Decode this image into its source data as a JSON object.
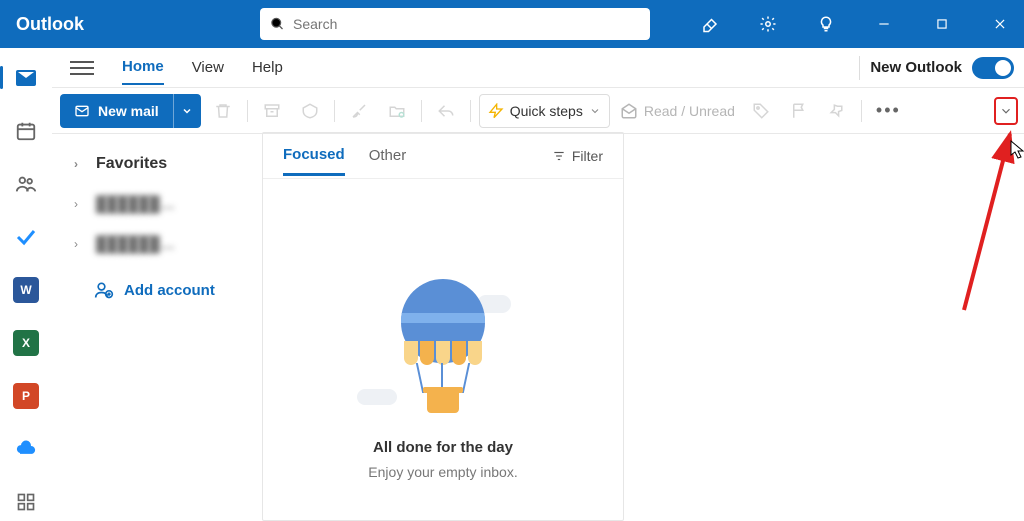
{
  "colors": {
    "brand": "#0F6CBD",
    "accent_red": "#e02020"
  },
  "titlebar": {
    "app_name": "Outlook",
    "search_placeholder": "Search"
  },
  "menubar": {
    "items": [
      "Home",
      "View",
      "Help"
    ],
    "new_outlook_label": "New Outlook"
  },
  "toolbar": {
    "new_mail_label": "New mail",
    "quick_steps_label": "Quick steps",
    "read_unread_label": "Read / Unread"
  },
  "sidebar": {
    "favorites_label": "Favorites",
    "account1": "██████…",
    "account2": "██████…",
    "add_account_label": "Add account"
  },
  "messages": {
    "tab_focused": "Focused",
    "tab_other": "Other",
    "filter_label": "Filter",
    "empty_title": "All done for the day",
    "empty_subtitle": "Enjoy your empty inbox."
  }
}
